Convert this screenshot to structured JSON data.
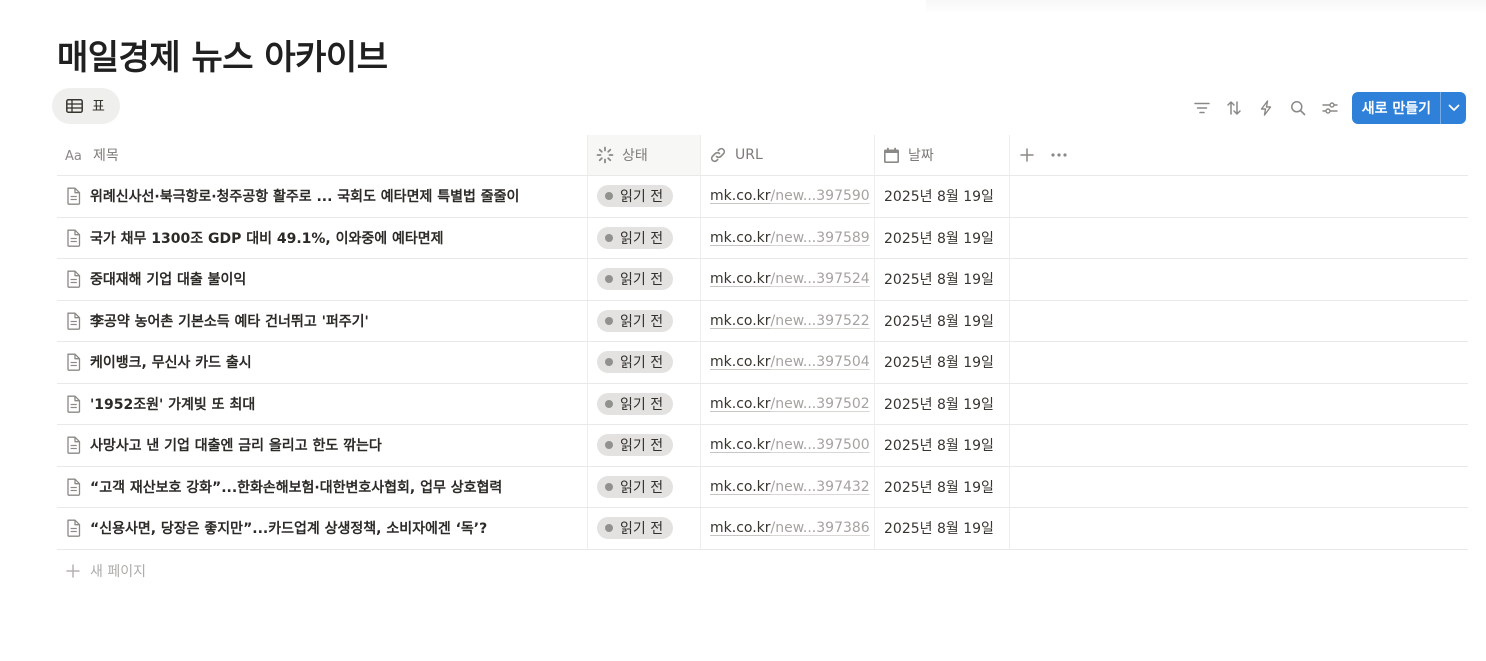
{
  "page": {
    "title": "매일경제 뉴스 아카이브"
  },
  "view_tab": {
    "icon": "table-icon",
    "label": "표"
  },
  "toolbar": {
    "icons": [
      "filter-icon",
      "sort-icon",
      "automation-icon",
      "search-icon",
      "settings-icon"
    ],
    "new_button_label": "새로 만들기",
    "accent_color": "#2f80d9"
  },
  "columns": {
    "title": {
      "label": "제목",
      "icon": "text-type-icon"
    },
    "status": {
      "label": "상태",
      "icon": "status-icon"
    },
    "url": {
      "label": "URL",
      "icon": "link-icon"
    },
    "date": {
      "label": "날짜",
      "icon": "calendar-icon"
    }
  },
  "rows": [
    {
      "title": "위례신사선·북극항로·청주공항 활주로 ... 국회도 예타면제 특별법 줄줄이",
      "status": "읽기 전",
      "url_host": "mk.co.kr",
      "url_rest": "/new...397590",
      "date": "2025년 8월 19일"
    },
    {
      "title": "국가 채무 1300조 GDP 대비 49.1%, 이와중에 예타면제",
      "status": "읽기 전",
      "url_host": "mk.co.kr",
      "url_rest": "/new...397589",
      "date": "2025년 8월 19일"
    },
    {
      "title": "중대재해 기업 대출 불이익",
      "status": "읽기 전",
      "url_host": "mk.co.kr",
      "url_rest": "/new...397524",
      "date": "2025년 8월 19일"
    },
    {
      "title": "李공약 농어촌 기본소득 예타 건너뛰고 '퍼주기'",
      "status": "읽기 전",
      "url_host": "mk.co.kr",
      "url_rest": "/new...397522",
      "date": "2025년 8월 19일"
    },
    {
      "title": "케이뱅크, 무신사 카드 출시",
      "status": "읽기 전",
      "url_host": "mk.co.kr",
      "url_rest": "/new...397504",
      "date": "2025년 8월 19일"
    },
    {
      "title": "'1952조원' 가계빚 또 최대",
      "status": "읽기 전",
      "url_host": "mk.co.kr",
      "url_rest": "/new...397502",
      "date": "2025년 8월 19일"
    },
    {
      "title": "사망사고 낸 기업 대출엔 금리 올리고 한도 깎는다",
      "status": "읽기 전",
      "url_host": "mk.co.kr",
      "url_rest": "/new...397500",
      "date": "2025년 8월 19일"
    },
    {
      "title": "“고객 재산보호 강화”...한화손해보험·대한변호사협회, 업무 상호협력",
      "status": "읽기 전",
      "url_host": "mk.co.kr",
      "url_rest": "/new...397432",
      "date": "2025년 8월 19일"
    },
    {
      "title": "“신용사면, 당장은 좋지만”...카드업계 상생정책, 소비자에겐 ‘독’?",
      "status": "읽기 전",
      "url_host": "mk.co.kr",
      "url_rest": "/new...397386",
      "date": "2025년 8월 19일"
    }
  ],
  "add_row_label": "새 페이지"
}
